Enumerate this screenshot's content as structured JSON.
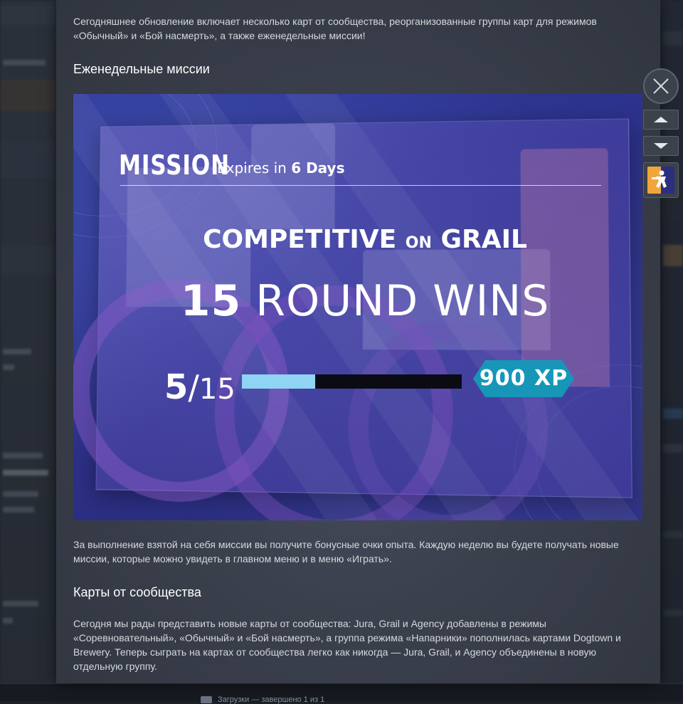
{
  "article": {
    "intro": "Сегодняшнее обновление включает несколько карт от сообщества, реорганизованные группы карт для режимов «Обычный» и «Бой насмерть», а также еженедельные миссии!",
    "section1_title": "Еженедельные миссии",
    "section1_text": "За выполнение взятой на себя миссии вы получите бонусные очки опыта. Каждую неделю вы будете получать новые миссии, которые можно увидеть в главном меню и в меню «Играть».",
    "section2_title": "Карты от сообщества",
    "section2_text": "Сегодня мы рады представить новые карты от сообщества: Jura, Grail и Agency добавлены в режимы «Соревновательный», «Обычный» и «Бой насмерть», а группа режима «Напарники» пополнилась картами Dogtown и Brewery. Теперь сыграть на картах от сообщества легко как никогда — Jura, Grail, и Agency объединены в новую отдельную группу."
  },
  "mission_banner": {
    "title": "MISSION",
    "expires_prefix": "Expires in",
    "expires_value": "6 Days",
    "mode": "COMPETITIVE",
    "mode_joiner": "ON",
    "map": "GRAIL",
    "goal_count": "15",
    "goal_text": "ROUND WINS",
    "progress_current": "5",
    "progress_sep": "/",
    "progress_total": "15",
    "progress_fraction": 0.333,
    "reward": "900 XP",
    "colors": {
      "progress_fill": "#8fd4f3",
      "progress_track": "#0b0b14",
      "reward_badge": "#1796b8"
    }
  },
  "controls": {
    "close_icon": "close-icon",
    "prev_icon": "chevron-up-icon",
    "next_icon": "chevron-down-icon",
    "game_icon": "counter-strike-icon"
  },
  "background_bar": {
    "status_text": "Загрузки — завершено 1 из 1"
  }
}
